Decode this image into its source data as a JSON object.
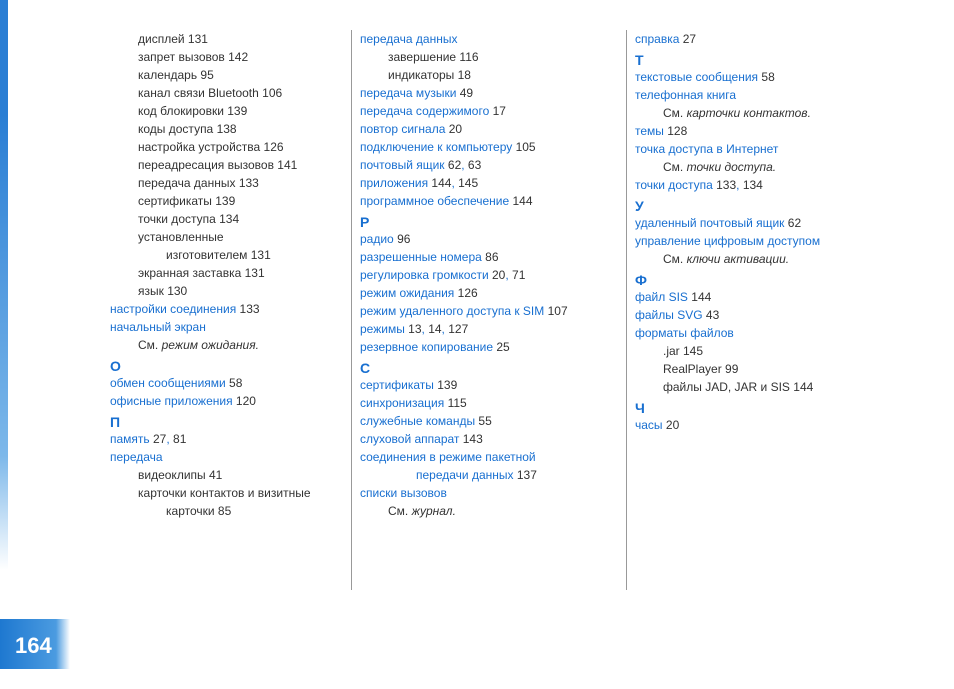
{
  "pageNumber": "164",
  "col1": [
    {
      "cls": "line indent1 black",
      "parts": [
        {
          "t": "дисплей",
          "link": false
        },
        {
          "t": " 131",
          "link": false
        }
      ]
    },
    {
      "cls": "line indent1 black",
      "parts": [
        {
          "t": "запрет вызовов",
          "link": false
        },
        {
          "t": " 142",
          "link": false
        }
      ]
    },
    {
      "cls": "line indent1 black",
      "parts": [
        {
          "t": "календарь",
          "link": false
        },
        {
          "t": " 95",
          "link": false
        }
      ]
    },
    {
      "cls": "line indent1 black",
      "parts": [
        {
          "t": "канал связи Bluetooth",
          "link": false
        },
        {
          "t": " 106",
          "link": false
        }
      ]
    },
    {
      "cls": "line indent1 black",
      "parts": [
        {
          "t": "код блокировки",
          "link": false
        },
        {
          "t": " 139",
          "link": false
        }
      ]
    },
    {
      "cls": "line indent1 black",
      "parts": [
        {
          "t": "коды доступа",
          "link": false
        },
        {
          "t": " 138",
          "link": false
        }
      ]
    },
    {
      "cls": "line indent1 black",
      "parts": [
        {
          "t": "настройка устройства",
          "link": false
        },
        {
          "t": " 126",
          "link": false
        }
      ]
    },
    {
      "cls": "line indent1 black",
      "parts": [
        {
          "t": "переадресация вызовов",
          "link": false
        },
        {
          "t": " 141",
          "link": false
        }
      ]
    },
    {
      "cls": "line indent1 black",
      "parts": [
        {
          "t": "передача данных",
          "link": false
        },
        {
          "t": " 133",
          "link": false
        }
      ]
    },
    {
      "cls": "line indent1 black",
      "parts": [
        {
          "t": "сертификаты",
          "link": false
        },
        {
          "t": " 139",
          "link": false
        }
      ]
    },
    {
      "cls": "line indent1 black",
      "parts": [
        {
          "t": "точки доступа",
          "link": false
        },
        {
          "t": " 134",
          "link": false
        }
      ]
    },
    {
      "cls": "line indent1 black",
      "parts": [
        {
          "t": "установленные",
          "link": false
        }
      ]
    },
    {
      "cls": "line indent2 black",
      "parts": [
        {
          "t": "изготовителем",
          "link": false
        },
        {
          "t": " 131",
          "link": false
        }
      ]
    },
    {
      "cls": "line indent1 black",
      "parts": [
        {
          "t": "экранная заставка",
          "link": false
        },
        {
          "t": " 131",
          "link": false
        }
      ]
    },
    {
      "cls": "line indent1 black",
      "parts": [
        {
          "t": "язык",
          "link": false
        },
        {
          "t": " 130",
          "link": false
        }
      ]
    },
    {
      "cls": "line",
      "parts": [
        {
          "t": "настройки соединения",
          "link": true
        },
        {
          "t": " 133",
          "link": false
        }
      ]
    },
    {
      "cls": "line",
      "parts": [
        {
          "t": "начальный экран",
          "link": true
        }
      ]
    },
    {
      "cls": "line indent1",
      "parts": [
        {
          "t": "См. ",
          "link": false
        },
        {
          "t": "режим ожидания.",
          "link": false,
          "italic": true
        }
      ]
    },
    {
      "cls": "section-head",
      "parts": [
        {
          "t": "О",
          "link": true
        }
      ]
    },
    {
      "cls": "line",
      "parts": [
        {
          "t": "обмен сообщениями",
          "link": true
        },
        {
          "t": " 58",
          "link": false
        }
      ]
    },
    {
      "cls": "line",
      "parts": [
        {
          "t": "офисные приложения",
          "link": true
        },
        {
          "t": " 120",
          "link": false
        }
      ]
    },
    {
      "cls": "section-head",
      "parts": [
        {
          "t": "П",
          "link": true
        }
      ]
    },
    {
      "cls": "line",
      "parts": [
        {
          "t": "память",
          "link": true
        },
        {
          "t": " 27",
          "link": false
        },
        {
          "t": ", ",
          "link": true
        },
        {
          "t": "81",
          "link": false
        }
      ]
    },
    {
      "cls": "line",
      "parts": [
        {
          "t": "передача",
          "link": true
        }
      ]
    },
    {
      "cls": "line indent1 black",
      "parts": [
        {
          "t": "видеоклипы",
          "link": false
        },
        {
          "t": " 41",
          "link": false
        }
      ]
    },
    {
      "cls": "line indent1 black",
      "parts": [
        {
          "t": "карточки контактов и визитные",
          "link": false
        }
      ]
    },
    {
      "cls": "line indent2 black",
      "parts": [
        {
          "t": "карточки",
          "link": false
        },
        {
          "t": " 85",
          "link": false
        }
      ]
    }
  ],
  "col2": [
    {
      "cls": "line",
      "parts": [
        {
          "t": "передача данных",
          "link": true
        }
      ]
    },
    {
      "cls": "line indent1 black",
      "parts": [
        {
          "t": "завершение",
          "link": false
        },
        {
          "t": " 116",
          "link": false
        }
      ]
    },
    {
      "cls": "line indent1 black",
      "parts": [
        {
          "t": "индикаторы",
          "link": false
        },
        {
          "t": " 18",
          "link": false
        }
      ]
    },
    {
      "cls": "line",
      "parts": [
        {
          "t": "передача музыки",
          "link": true
        },
        {
          "t": " 49",
          "link": false
        }
      ]
    },
    {
      "cls": "line",
      "parts": [
        {
          "t": "передача содержимого",
          "link": true
        },
        {
          "t": " 17",
          "link": false
        }
      ]
    },
    {
      "cls": "line",
      "parts": [
        {
          "t": "повтор сигнала",
          "link": true
        },
        {
          "t": " 20",
          "link": false
        }
      ]
    },
    {
      "cls": "line",
      "parts": [
        {
          "t": "подключение к компьютеру",
          "link": true
        },
        {
          "t": " 105",
          "link": false
        }
      ]
    },
    {
      "cls": "line",
      "parts": [
        {
          "t": "почтовый ящик",
          "link": true
        },
        {
          "t": " 62",
          "link": false
        },
        {
          "t": ", ",
          "link": true
        },
        {
          "t": "63",
          "link": false
        }
      ]
    },
    {
      "cls": "line",
      "parts": [
        {
          "t": "приложения",
          "link": true
        },
        {
          "t": " 144",
          "link": false
        },
        {
          "t": ", ",
          "link": true
        },
        {
          "t": "145",
          "link": false
        }
      ]
    },
    {
      "cls": "line",
      "parts": [
        {
          "t": "программное обеспечение",
          "link": true
        },
        {
          "t": " 144",
          "link": false
        }
      ]
    },
    {
      "cls": "section-head",
      "parts": [
        {
          "t": "Р",
          "link": true
        }
      ]
    },
    {
      "cls": "line",
      "parts": [
        {
          "t": "радио",
          "link": true
        },
        {
          "t": " 96",
          "link": false
        }
      ]
    },
    {
      "cls": "line",
      "parts": [
        {
          "t": "разрешенные номера",
          "link": true
        },
        {
          "t": " 86",
          "link": false
        }
      ]
    },
    {
      "cls": "line",
      "parts": [
        {
          "t": "регулировка громкости",
          "link": true
        },
        {
          "t": " 20",
          "link": false
        },
        {
          "t": ", ",
          "link": true
        },
        {
          "t": "71",
          "link": false
        }
      ]
    },
    {
      "cls": "line",
      "parts": [
        {
          "t": "режим ожидания",
          "link": true
        },
        {
          "t": " 126",
          "link": false
        }
      ]
    },
    {
      "cls": "line",
      "parts": [
        {
          "t": "режим удаленного доступа к SIM",
          "link": true
        },
        {
          "t": " 107",
          "link": false
        }
      ]
    },
    {
      "cls": "line",
      "parts": [
        {
          "t": "режимы",
          "link": true
        },
        {
          "t": " 13",
          "link": false
        },
        {
          "t": ", ",
          "link": true
        },
        {
          "t": "14",
          "link": false
        },
        {
          "t": ", ",
          "link": true
        },
        {
          "t": "127",
          "link": false
        }
      ]
    },
    {
      "cls": "line",
      "parts": [
        {
          "t": "резервное копирование",
          "link": true
        },
        {
          "t": " 25",
          "link": false
        }
      ]
    },
    {
      "cls": "section-head",
      "parts": [
        {
          "t": "С",
          "link": true
        }
      ]
    },
    {
      "cls": "line",
      "parts": [
        {
          "t": "сертификаты",
          "link": true
        },
        {
          "t": " 139",
          "link": false
        }
      ]
    },
    {
      "cls": "line",
      "parts": [
        {
          "t": "синхронизация",
          "link": true
        },
        {
          "t": " 115",
          "link": false
        }
      ]
    },
    {
      "cls": "line",
      "parts": [
        {
          "t": "служебные команды",
          "link": true
        },
        {
          "t": " 55",
          "link": false
        }
      ]
    },
    {
      "cls": "line",
      "parts": [
        {
          "t": "слуховой аппарат",
          "link": true
        },
        {
          "t": " 143",
          "link": false
        }
      ]
    },
    {
      "cls": "line",
      "parts": [
        {
          "t": "соединения в режиме пакетной",
          "link": true
        }
      ]
    },
    {
      "cls": "line indent2",
      "parts": [
        {
          "t": "передачи данных",
          "link": true
        },
        {
          "t": " 137",
          "link": false
        }
      ]
    },
    {
      "cls": "line",
      "parts": [
        {
          "t": "списки вызовов",
          "link": true
        }
      ]
    },
    {
      "cls": "line indent1",
      "parts": [
        {
          "t": "См. ",
          "link": false
        },
        {
          "t": "журнал.",
          "link": false,
          "italic": true
        }
      ]
    }
  ],
  "col3": [
    {
      "cls": "line",
      "parts": [
        {
          "t": "справка",
          "link": true
        },
        {
          "t": " 27",
          "link": false
        }
      ]
    },
    {
      "cls": "section-head",
      "parts": [
        {
          "t": "Т",
          "link": true
        }
      ]
    },
    {
      "cls": "line",
      "parts": [
        {
          "t": "текстовые сообщения",
          "link": true
        },
        {
          "t": " 58",
          "link": false
        }
      ]
    },
    {
      "cls": "line",
      "parts": [
        {
          "t": "телефонная книга",
          "link": true
        }
      ]
    },
    {
      "cls": "line indent1",
      "parts": [
        {
          "t": "См. ",
          "link": false
        },
        {
          "t": "карточки контактов.",
          "link": false,
          "italic": true
        }
      ]
    },
    {
      "cls": "line",
      "parts": [
        {
          "t": "темы",
          "link": true
        },
        {
          "t": " 128",
          "link": false
        }
      ]
    },
    {
      "cls": "line",
      "parts": [
        {
          "t": "точка доступа в Интернет",
          "link": true
        }
      ]
    },
    {
      "cls": "line indent1",
      "parts": [
        {
          "t": "См. ",
          "link": false
        },
        {
          "t": "точки доступа.",
          "link": false,
          "italic": true
        }
      ]
    },
    {
      "cls": "line",
      "parts": [
        {
          "t": "точки доступа",
          "link": true
        },
        {
          "t": " 133",
          "link": false
        },
        {
          "t": ", ",
          "link": true
        },
        {
          "t": "134",
          "link": false
        }
      ]
    },
    {
      "cls": "section-head",
      "parts": [
        {
          "t": "У",
          "link": true
        }
      ]
    },
    {
      "cls": "line",
      "parts": [
        {
          "t": "удаленный почтовый ящик",
          "link": true
        },
        {
          "t": " 62",
          "link": false
        }
      ]
    },
    {
      "cls": "line",
      "parts": [
        {
          "t": "управление цифровым доступом",
          "link": true
        }
      ]
    },
    {
      "cls": "line indent1",
      "parts": [
        {
          "t": "См. ",
          "link": false
        },
        {
          "t": "ключи активации.",
          "link": false,
          "italic": true
        }
      ]
    },
    {
      "cls": "section-head",
      "parts": [
        {
          "t": "Ф",
          "link": true
        }
      ]
    },
    {
      "cls": "line",
      "parts": [
        {
          "t": "файл SIS",
          "link": true
        },
        {
          "t": " 144",
          "link": false
        }
      ]
    },
    {
      "cls": "line",
      "parts": [
        {
          "t": "файлы SVG",
          "link": true
        },
        {
          "t": " 43",
          "link": false
        }
      ]
    },
    {
      "cls": "line",
      "parts": [
        {
          "t": "форматы файлов",
          "link": true
        }
      ]
    },
    {
      "cls": "line indent1 black",
      "parts": [
        {
          "t": ".jar",
          "link": false
        },
        {
          "t": " 145",
          "link": false
        }
      ]
    },
    {
      "cls": "line indent1 black",
      "parts": [
        {
          "t": "RealPlayer",
          "link": false
        },
        {
          "t": " 99",
          "link": false
        }
      ]
    },
    {
      "cls": "line indent1 black",
      "parts": [
        {
          "t": "файлы JAD, JAR и SIS",
          "link": false
        },
        {
          "t": " 144",
          "link": false
        }
      ]
    },
    {
      "cls": "section-head",
      "parts": [
        {
          "t": "Ч",
          "link": true
        }
      ]
    },
    {
      "cls": "line",
      "parts": [
        {
          "t": "часы",
          "link": true
        },
        {
          "t": " 20",
          "link": false
        }
      ]
    }
  ]
}
